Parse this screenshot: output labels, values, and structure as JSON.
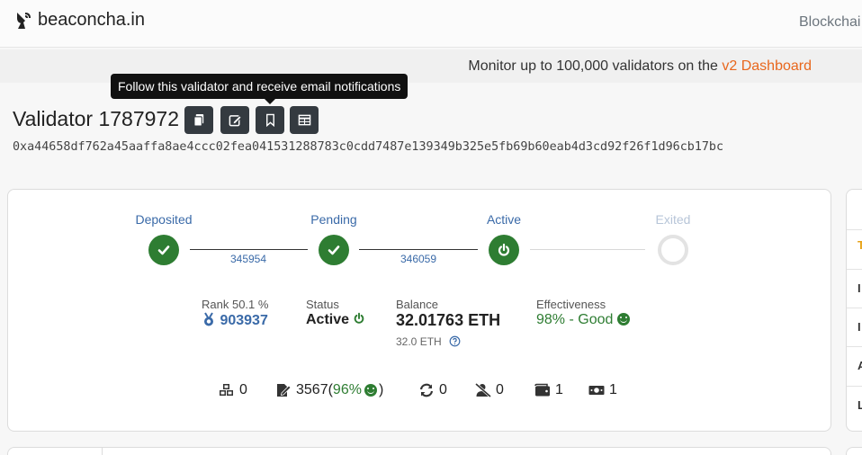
{
  "nav": {
    "brand": "beaconcha.in",
    "brand_icon": "satellite-dish-icon",
    "link": "Blockchai"
  },
  "banner": {
    "text": "Monitor up to 100,000 validators on the ",
    "link": "v2 Dashboard",
    "link_color": "#e8671d"
  },
  "tooltip": "Follow this validator and receive email notifications",
  "validator": {
    "title": "Validator 1787972",
    "pubkey": "0xa44658df762a45aaffa8ae4ccc02fea041531288783c0cdd7487e139349b325e5fb69b60eab4d3cd92f26f1d96cb17bc",
    "actions": [
      {
        "icon": "copy-icon"
      },
      {
        "icon": "edit-icon"
      },
      {
        "icon": "bookmark-icon"
      },
      {
        "icon": "table-icon"
      }
    ]
  },
  "lifecycle": {
    "steps": [
      {
        "label": "Deposited",
        "state": "done",
        "icon": "check-icon"
      },
      {
        "label": "Pending",
        "state": "done",
        "icon": "check-icon"
      },
      {
        "label": "Active",
        "state": "active",
        "icon": "power-icon"
      },
      {
        "label": "Exited",
        "state": "inactive"
      }
    ],
    "epochs": [
      "345954",
      "346059"
    ]
  },
  "stats": {
    "rank_label": "Rank 50.1 %",
    "rank_value": "903937",
    "rank_icon": "medal-icon",
    "status_label": "Status",
    "status_value": "Active",
    "balance_label": "Balance",
    "balance_value": "32.01763 ETH",
    "balance_sub": "32.0 ETH",
    "effectiveness_label": "Effectiveness",
    "effectiveness_value": "98% - Good"
  },
  "counters": {
    "proposals": "0",
    "attestations": "3567",
    "attestations_open": "(",
    "attestations_pct": "96%",
    "attestations_close": ")",
    "sync": "0",
    "slashings": "0",
    "deposits": "1",
    "withdrawals": "1"
  },
  "side_panel": {
    "letters": [
      "T",
      "I",
      "I",
      "A",
      "L"
    ]
  },
  "colors": {
    "accent_green": "#2e7d32",
    "link_blue": "#3a6aa8",
    "dark_button": "#343a40"
  }
}
